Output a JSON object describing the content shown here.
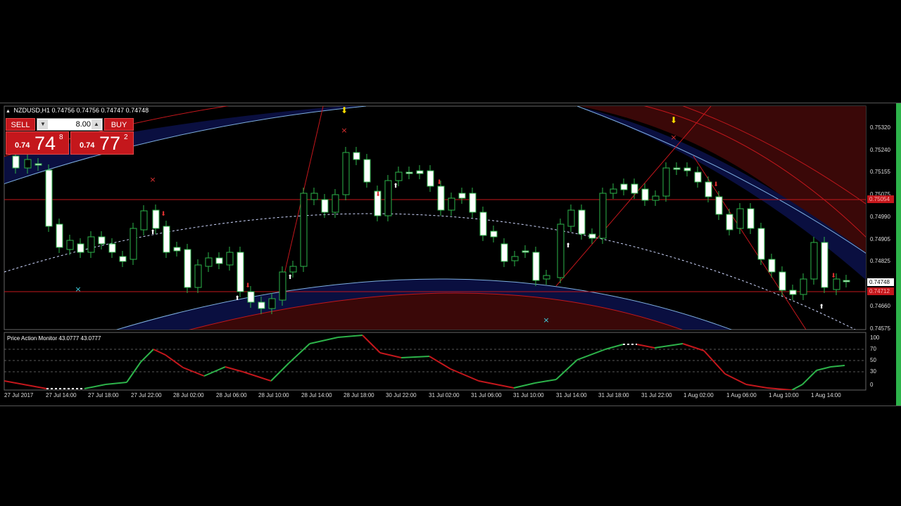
{
  "header": {
    "symbol": "NZDUSD,H1",
    "ohlc": "0.74756 0.74756 0.74747 0.74748"
  },
  "trade_panel": {
    "sell_label": "SELL",
    "buy_label": "BUY",
    "lot_value": "8.00",
    "sell_price": {
      "prefix": "0.74",
      "big": "74",
      "sup": "8"
    },
    "buy_price": {
      "prefix": "0.74",
      "big": "77",
      "sup": "2"
    }
  },
  "price_axis": {
    "ticks": [
      "0.75320",
      "0.75240",
      "0.75155",
      "0.75075",
      "0.74990",
      "0.74905",
      "0.74825",
      "0.74660",
      "0.74575"
    ],
    "bid_label": "0.74748",
    "ask_label": "0.74712",
    "ref_label": "0.75054"
  },
  "indicator": {
    "title": "Price Action Monitor 43.0777 43.0777",
    "levels": [
      "100",
      "70",
      "50",
      "30",
      "0"
    ]
  },
  "time_axis": [
    "27 Jul 2017",
    "27 Jul 14:00",
    "27 Jul 18:00",
    "27 Jul 22:00",
    "28 Jul 02:00",
    "28 Jul 06:00",
    "28 Jul 10:00",
    "28 Jul 14:00",
    "28 Jul 18:00",
    "30 Jul 22:00",
    "31 Jul 02:00",
    "31 Jul 06:00",
    "31 Jul 10:00",
    "31 Jul 14:00",
    "31 Jul 18:00",
    "31 Jul 22:00",
    "1 Aug 02:00",
    "1 Aug 06:00",
    "1 Aug 10:00",
    "1 Aug 14:00"
  ],
  "colors": {
    "bull_candle": "#ffffff",
    "bear_candle": "#000000",
    "wick": "#2db34a",
    "band_blue": "#0a0f40",
    "band_red": "#3a0808",
    "red_line": "#c4171c",
    "indicator_up": "#2db34a",
    "indicator_down": "#c4171c"
  }
}
